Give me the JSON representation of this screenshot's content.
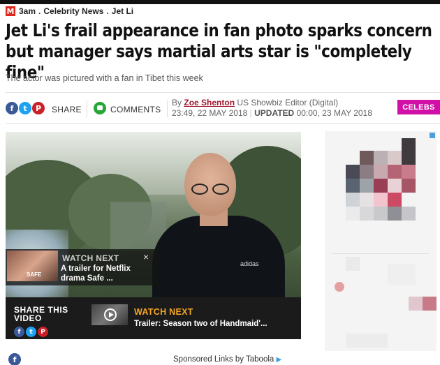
{
  "breadcrumb": {
    "logo": "M",
    "items": [
      "3am",
      "Celebrity News",
      "Jet Li"
    ],
    "separator": "."
  },
  "article": {
    "headline": "Jet Li's frail appearance in fan photo sparks concern but manager says martial arts star is \"completely fine\"",
    "subhead": "The actor was pictured with a fan in Tibet this week"
  },
  "share": {
    "share_label": "SHARE",
    "comments_label": "COMMENTS",
    "icons": [
      "facebook-icon",
      "twitter-icon",
      "pinterest-icon"
    ],
    "fb": "f",
    "tw": "t",
    "pin": "P"
  },
  "byline": {
    "by": "By",
    "author": "Zoe Shenton",
    "role": "US Showbiz Editor (Digital)",
    "published": "23:49, 22 MAY 2018",
    "updated_label": "UPDATED",
    "updated": "00:00, 23 MAY 2018"
  },
  "category_badge": {
    "label": "CELEBS",
    "color": "#d20fa6"
  },
  "watch_next_overlay": {
    "title": "WATCH NEXT",
    "text": "A trailer for Netflix drama Safe ...",
    "thumb_tag": "SAFE",
    "close": "×"
  },
  "video_bar": {
    "share_title": "SHARE THIS VIDEO",
    "watch_next_title": "WATCH NEXT",
    "watch_next_text": "Trailer: Season two of Handmaid'...",
    "watch_next_color": "#f5a623"
  },
  "photo": {
    "shirt_logo": "adidas"
  },
  "footer": {
    "sponsored": "Sponsored Links",
    "by": "by Taboola",
    "fb": "f"
  },
  "colors": {
    "brand": "#e0261b",
    "author": "#a0162c"
  }
}
